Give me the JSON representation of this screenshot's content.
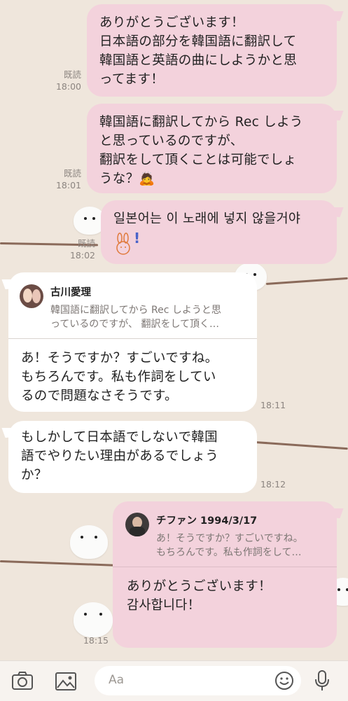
{
  "messages": [
    {
      "text": "ありがとうございます！\n日本語の部分を韓国語に翻訳して\n韓国語と英語の曲にしようかと思\nってます！",
      "read": "既読",
      "time": "18:00"
    },
    {
      "text": "韓国語に翻訳してから Rec しよう\nと思っているのですが、\n翻訳をして頂くことは可能でしょ\nうな？",
      "emoji": "🙇",
      "read": "既読",
      "time": "18:01"
    },
    {
      "text": "일본어는 이 노래에 넣지 않을거야",
      "sticker_mark": "!",
      "read": "既読",
      "time": "18:02"
    },
    {
      "reply_name": "古川愛理",
      "reply_text": "韓国語に翻訳してから Rec しようと思\nっているのですが、 翻訳をして頂く…",
      "text": "あ！そうですか？すごいですね。\nもちろんです。私も作詞をしてい\nるので問題なさそうです。",
      "time": "18:11"
    },
    {
      "text": "もしかして日本語でしないで韓国\n語でやりたい理由があるでしょう\nか？",
      "time": "18:12"
    },
    {
      "reply_name": "チファン 1994/3/17",
      "reply_text": "あ！そうですか？すごいですね。\nもちろんです。私も作詞をして…",
      "text": "ありがとうございます！\n감사합니다！",
      "time": "18:15"
    }
  ],
  "input": {
    "placeholder": "Aa"
  },
  "icons": {
    "camera": "camera-icon",
    "image": "image-icon",
    "emoji": "emoji-icon",
    "mic": "microphone-icon"
  },
  "colors": {
    "background": "#efe6dc",
    "my_bubble": "#f3d2dc",
    "their_bubble": "#ffffff"
  }
}
